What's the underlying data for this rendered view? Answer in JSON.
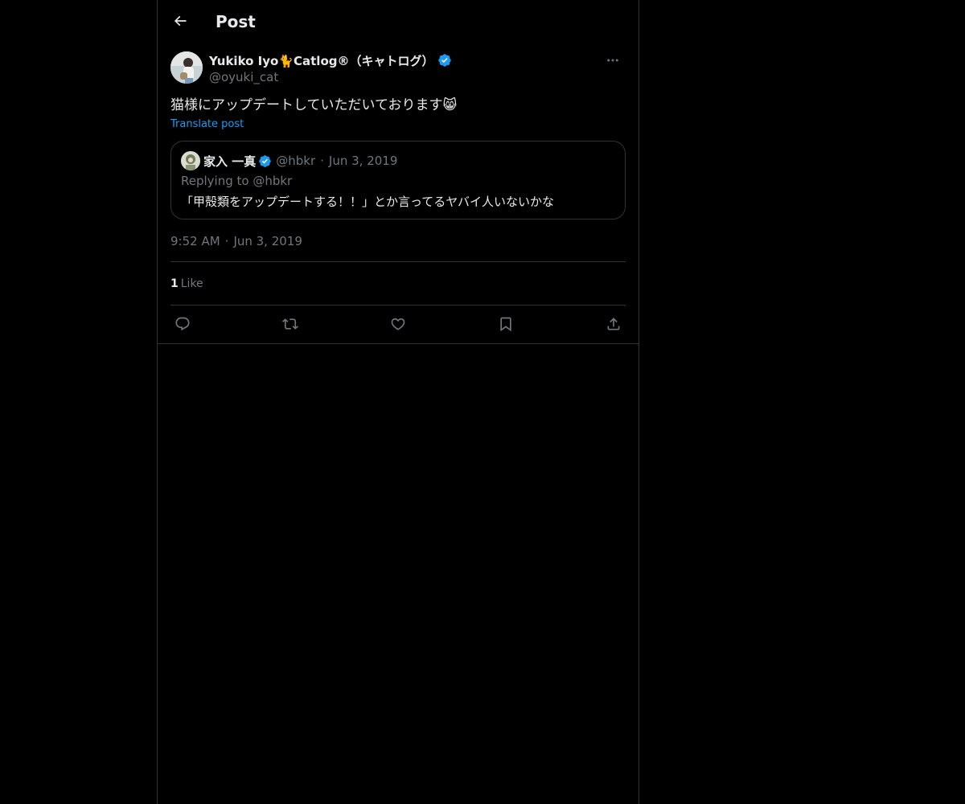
{
  "header": {
    "back_icon": "arrow-left-icon",
    "title": "Post"
  },
  "post": {
    "author": {
      "display_name": "Yukiko Iyo🐈Catlog®（キャトログ）",
      "handle": "@oyuki_cat",
      "verified": true
    },
    "more_icon": "more-horizontal-icon",
    "text": "猫様にアップデートしていただいております😸",
    "translate_label": "Translate post",
    "quote": {
      "author_name": "家入 一真",
      "author_handle": "@hbkr",
      "dot": "·",
      "date": "Jun 3, 2019",
      "replying_to": "Replying to @hbkr",
      "text": "「甲殻類をアップデートする！！」とか言ってるヤバイ人いないかな"
    },
    "timestamp": {
      "time": "9:52 AM",
      "dot": "·",
      "date": "Jun 3, 2019"
    },
    "likes": {
      "count": "1",
      "label": "Like"
    },
    "actions": [
      "reply-icon",
      "repost-icon",
      "like-icon",
      "bookmark-icon",
      "share-icon"
    ]
  },
  "colors": {
    "background": "#000000",
    "text_primary": "#e7e9ea",
    "text_secondary": "#71767b",
    "accent": "#1d9bf0",
    "border": "#2f3336"
  }
}
